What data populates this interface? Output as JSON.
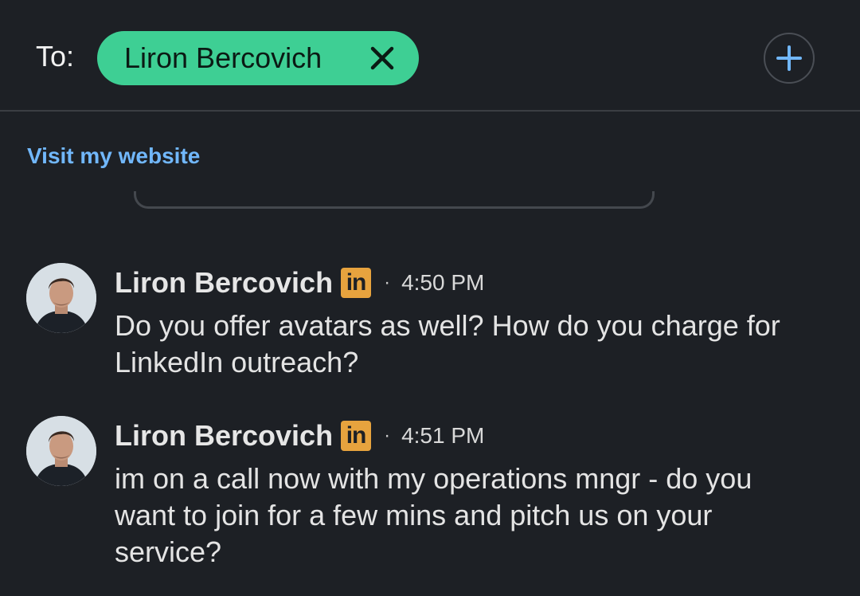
{
  "header": {
    "to_label": "To:",
    "recipient_chip": "Liron Bercovich",
    "close_icon": "close-icon",
    "add_icon": "plus-icon"
  },
  "link": {
    "text": "Visit my website"
  },
  "messages": [
    {
      "sender": "Liron Bercovich",
      "badge": "in",
      "separator": "·",
      "time": "4:50 PM",
      "text": "Do you offer avatars as well? How do you charge for LinkedIn outreach?"
    },
    {
      "sender": "Liron Bercovich",
      "badge": "in",
      "separator": "·",
      "time": "4:51 PM",
      "text": "im on a call now with my operations mngr - do you want to join for a few mins and pitch us on your service?"
    }
  ],
  "colors": {
    "background": "#1d2025",
    "chip": "#3ecf94",
    "link": "#71b7fb",
    "linkedin_badge": "#e7a33e"
  }
}
